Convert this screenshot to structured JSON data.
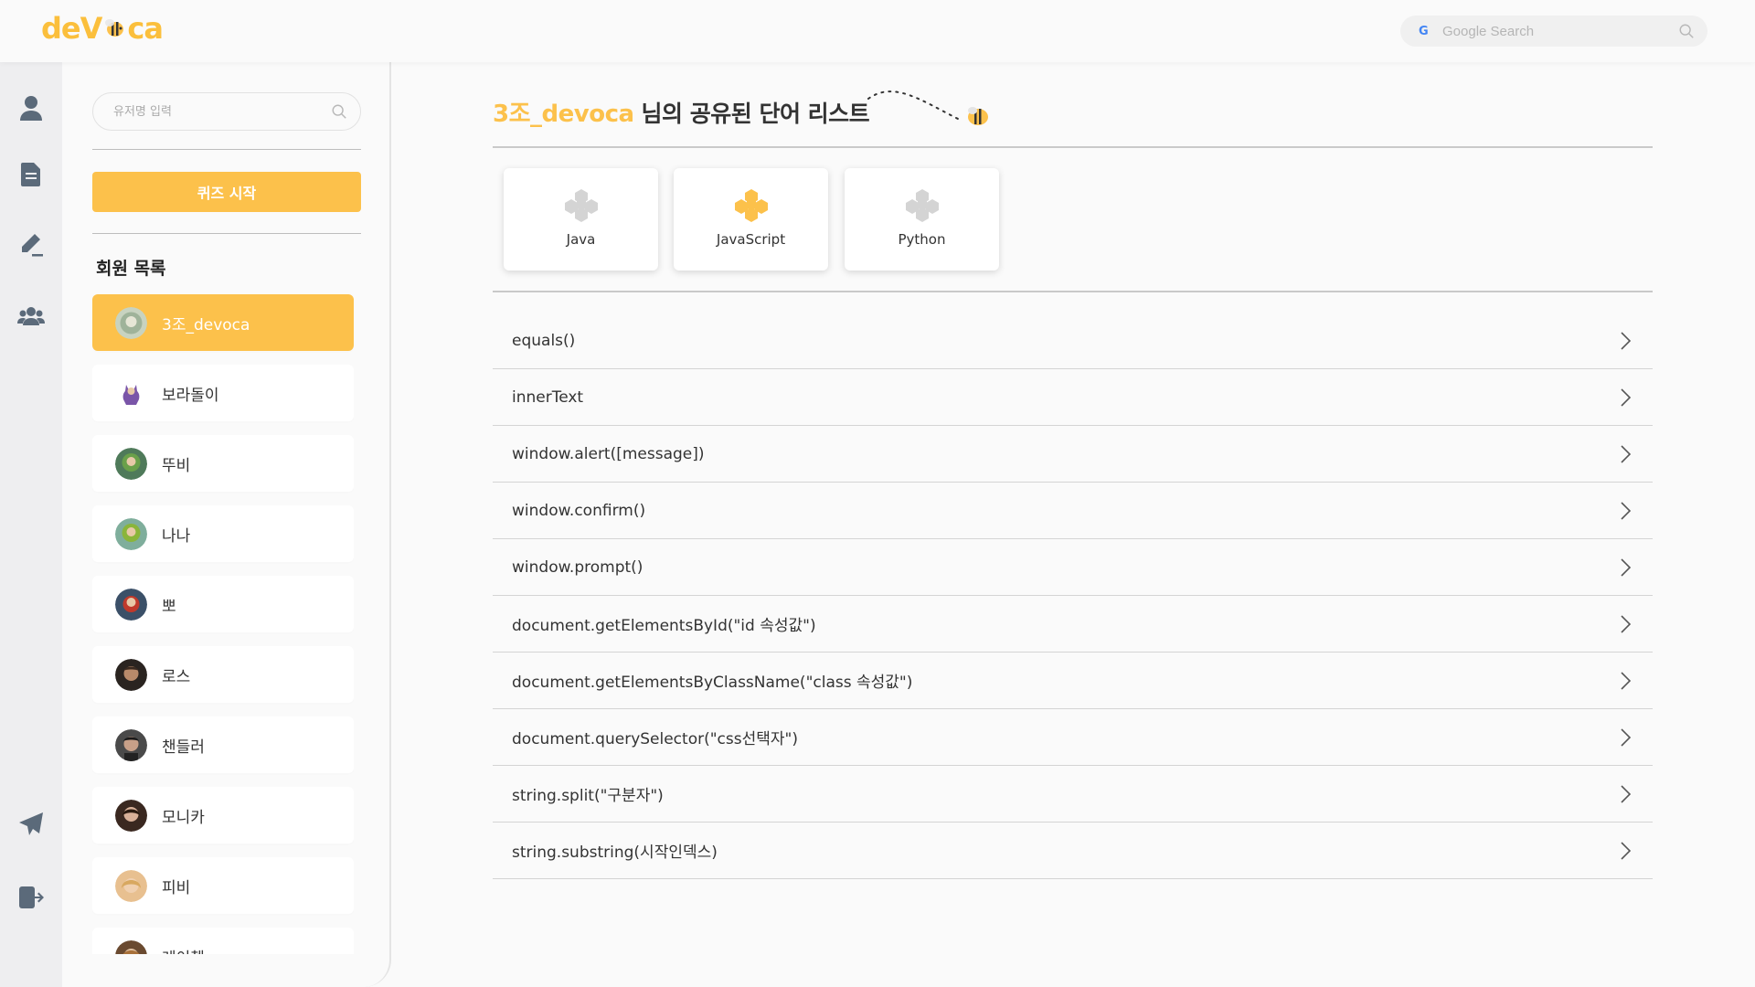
{
  "header": {
    "logo_left": "deV",
    "logo_right": "ca",
    "search_placeholder": "Google Search"
  },
  "rail": {
    "icons": [
      "profile-icon",
      "document-icon",
      "pen-icon",
      "group-icon",
      "send-icon",
      "logout-icon"
    ]
  },
  "sidebar": {
    "search_placeholder": "유저명 입력",
    "quiz_button": "퀴즈 시작",
    "members_title": "회원 목록",
    "members": [
      {
        "name": "3조_devoca",
        "active": true,
        "avatar_color": "#c8d3c0"
      },
      {
        "name": "보라돌이",
        "active": false,
        "avatar_color": "#7a55a8"
      },
      {
        "name": "뚜비",
        "active": false,
        "avatar_color": "#6aa04a"
      },
      {
        "name": "나나",
        "active": false,
        "avatar_color": "#8ab53a"
      },
      {
        "name": "뽀",
        "active": false,
        "avatar_color": "#c0392b"
      },
      {
        "name": "로스",
        "active": false,
        "avatar_color": "#4a3426"
      },
      {
        "name": "챈들러",
        "active": false,
        "avatar_color": "#3a3a3a"
      },
      {
        "name": "모니카",
        "active": false,
        "avatar_color": "#5a3e30"
      },
      {
        "name": "피비",
        "active": false,
        "avatar_color": "#e0b27a"
      },
      {
        "name": "레이첼",
        "active": false,
        "avatar_color": "#a8703a"
      }
    ]
  },
  "main": {
    "title_user": "3조_devoca",
    "title_rest": "님의 공유된 단어 리스트",
    "categories": [
      {
        "label": "Java",
        "color": "#d4d4d4"
      },
      {
        "label": "JavaScript",
        "color": "#fcc14b"
      },
      {
        "label": "Python",
        "color": "#d4d4d4"
      }
    ],
    "words": [
      "equals()",
      "innerText",
      "window.alert([message])",
      "window.confirm()",
      "window.prompt()",
      "document.getElementsById(\"id 속성값\")",
      "document.getElementsByClassName(\"class 속성값\")",
      "document.querySelector(\"css선택자\")",
      "string.split(\"구분자\")",
      "string.substring(시작인덱스)"
    ]
  },
  "colors": {
    "accent": "#fcc14b",
    "rail_bg": "#eeeef0",
    "icon": "#5b6a7a"
  }
}
